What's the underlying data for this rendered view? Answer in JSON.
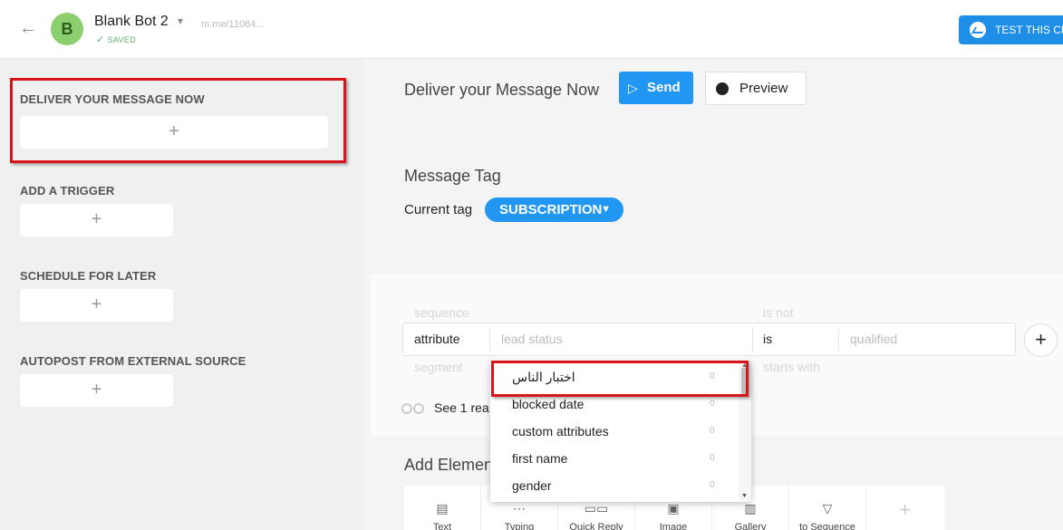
{
  "header": {
    "back_icon": "arrow-left-icon",
    "avatar_letter": "B",
    "bot_name": "Blank Bot 2",
    "saved_label": "SAVED",
    "bot_link": "m.me/11064...",
    "test_button_label": "TEST THIS CH"
  },
  "sidebar": {
    "sections": [
      {
        "title": "DELIVER YOUR MESSAGE NOW",
        "add": "+"
      },
      {
        "title": "ADD A TRIGGER",
        "add": "+"
      },
      {
        "title": "SCHEDULE FOR LATER",
        "add": "+"
      },
      {
        "title": "AUTOPOST FROM EXTERNAL SOURCE",
        "add": "+"
      }
    ]
  },
  "main": {
    "deliver_title": "Deliver your Message Now",
    "send_label": "Send",
    "preview_label": "Preview",
    "tag_title": "Message Tag",
    "current_tag_label": "Current tag",
    "current_tag_value": "SUBSCRIPTION",
    "filter": {
      "ghost_above": [
        "sequence",
        "is not"
      ],
      "ghost_below": [
        "segment",
        "starts with"
      ],
      "field": "attribute",
      "attribute_placeholder": "lead status",
      "operator": "is",
      "value_placeholder": "qualified",
      "add_symbol": "+"
    },
    "see_reach": "See 1 rea",
    "add_elements_title": "Add Elemen",
    "elements": [
      {
        "icon": "text-icon",
        "glyph": "▤",
        "label": "Text"
      },
      {
        "icon": "typing-icon",
        "glyph": "⋯",
        "label": "Typing"
      },
      {
        "icon": "quick-reply-icon",
        "glyph": "▭▭",
        "label": "Quick Reply"
      },
      {
        "icon": "image-icon",
        "glyph": "▣",
        "label": "Image"
      },
      {
        "icon": "gallery-icon",
        "glyph": "▥",
        "label": "Gallery"
      },
      {
        "icon": "filter-icon",
        "glyph": "▽",
        "label": "to Sequence"
      },
      {
        "icon": "plus-icon",
        "glyph": "+",
        "label": ""
      }
    ]
  },
  "dropdown": {
    "items": [
      {
        "label": "اختبار الناس",
        "count": "0"
      },
      {
        "label": "blocked date",
        "count": "0"
      },
      {
        "label": "custom attributes",
        "count": "0"
      },
      {
        "label": "first name",
        "count": "0"
      },
      {
        "label": "gender",
        "count": "0"
      }
    ]
  },
  "colors": {
    "accent_blue": "#2196f3",
    "highlight_red": "#d6161b",
    "avatar_green": "#8bcf6f",
    "saved_green": "#5db36b"
  }
}
